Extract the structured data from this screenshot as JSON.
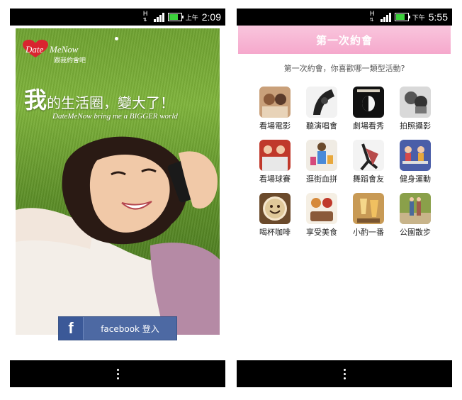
{
  "left": {
    "statusbar": {
      "data_icon": "H",
      "ampm": "上午",
      "time": "2:09"
    },
    "logo": {
      "date": "Date",
      "menow": "MeNow",
      "sub": "跟我約會吧"
    },
    "headline": {
      "big": "我",
      "rest": "的生活圈，變大了！"
    },
    "tagline": "DateMeNow bring me a BIGGER world",
    "facebook": {
      "icon": "f",
      "label": "facebook 登入"
    },
    "colors": {
      "brand_red": "#d9242f",
      "facebook_blue": "#4d69a3"
    }
  },
  "right": {
    "statusbar": {
      "data_icon": "H",
      "ampm": "下午",
      "time": "5:55"
    },
    "title": "第一次約會",
    "question": "第一次約會，你喜歡哪一類型活動?",
    "categories": [
      {
        "label": "看場電影",
        "icon": "movie-icon",
        "color": "#c9a07a"
      },
      {
        "label": "聽演唱會",
        "icon": "concert-icon",
        "color": "#222222"
      },
      {
        "label": "劇場看秀",
        "icon": "theater-icon",
        "color": "#111111"
      },
      {
        "label": "拍照攝影",
        "icon": "camera-icon",
        "color": "#999999"
      },
      {
        "label": "看場球賽",
        "icon": "ballgame-icon",
        "color": "#c0392b"
      },
      {
        "label": "逛街血拼",
        "icon": "shopping-icon",
        "color": "#d8d0c0"
      },
      {
        "label": "舞蹈會友",
        "icon": "dance-icon",
        "color": "#b84b4b"
      },
      {
        "label": "健身運動",
        "icon": "fitness-icon",
        "color": "#4a5ea8"
      },
      {
        "label": "喝杯咖啡",
        "icon": "coffee-icon",
        "color": "#6b4a2b"
      },
      {
        "label": "享受美食",
        "icon": "food-icon",
        "color": "#d68a3c"
      },
      {
        "label": "小酌一番",
        "icon": "drinks-icon",
        "color": "#c89a55"
      },
      {
        "label": "公園散步",
        "icon": "park-icon",
        "color": "#8aa04a"
      }
    ],
    "colors": {
      "title_bar": "#f5a8cc"
    }
  }
}
